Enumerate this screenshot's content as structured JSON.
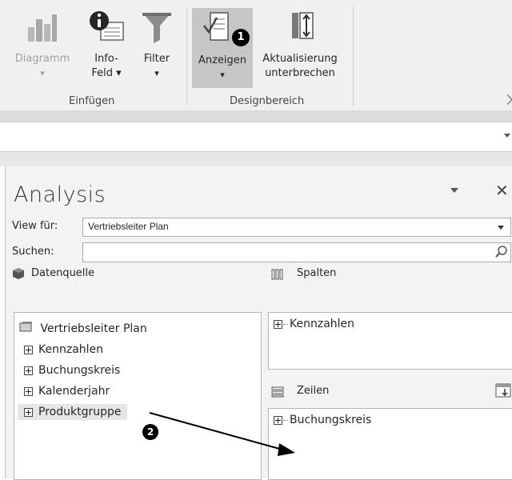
{
  "ribbon": {
    "buttons": {
      "diagramm": "Diagramm",
      "infofeld_line1": "Info-",
      "infofeld_line2": "Feld ▾",
      "filter": "Filter",
      "anzeigen": "Anzeigen",
      "aktualisierung_line1": "Aktualisierung",
      "aktualisierung_line2": "unterbrechen",
      "dropdown_arrow": "▾"
    },
    "groups": {
      "einfuegen": "Einfügen",
      "designbereich": "Designbereich"
    },
    "callout_1": "1"
  },
  "analysis": {
    "title": "Analysis",
    "view_label": "View für:",
    "view_value": "Vertriebsleiter Plan",
    "search_label": "Suchen:",
    "search_value": "",
    "datenquelle": {
      "header": "Datenquelle",
      "root": "Vertriebsleiter Plan",
      "items": [
        "Kennzahlen",
        "Buchungskreis",
        "Kalenderjahr",
        "Produktgruppe"
      ]
    },
    "spalten": {
      "header": "Spalten",
      "items": [
        "Kennzahlen"
      ]
    },
    "zeilen": {
      "header": "Zeilen",
      "items": [
        "Buchungskreis"
      ]
    },
    "callout_2": "2"
  },
  "colors": {
    "selected_button": "#c6c6c6",
    "callout": "#000000",
    "pane_bg": "#f3f3f3"
  }
}
